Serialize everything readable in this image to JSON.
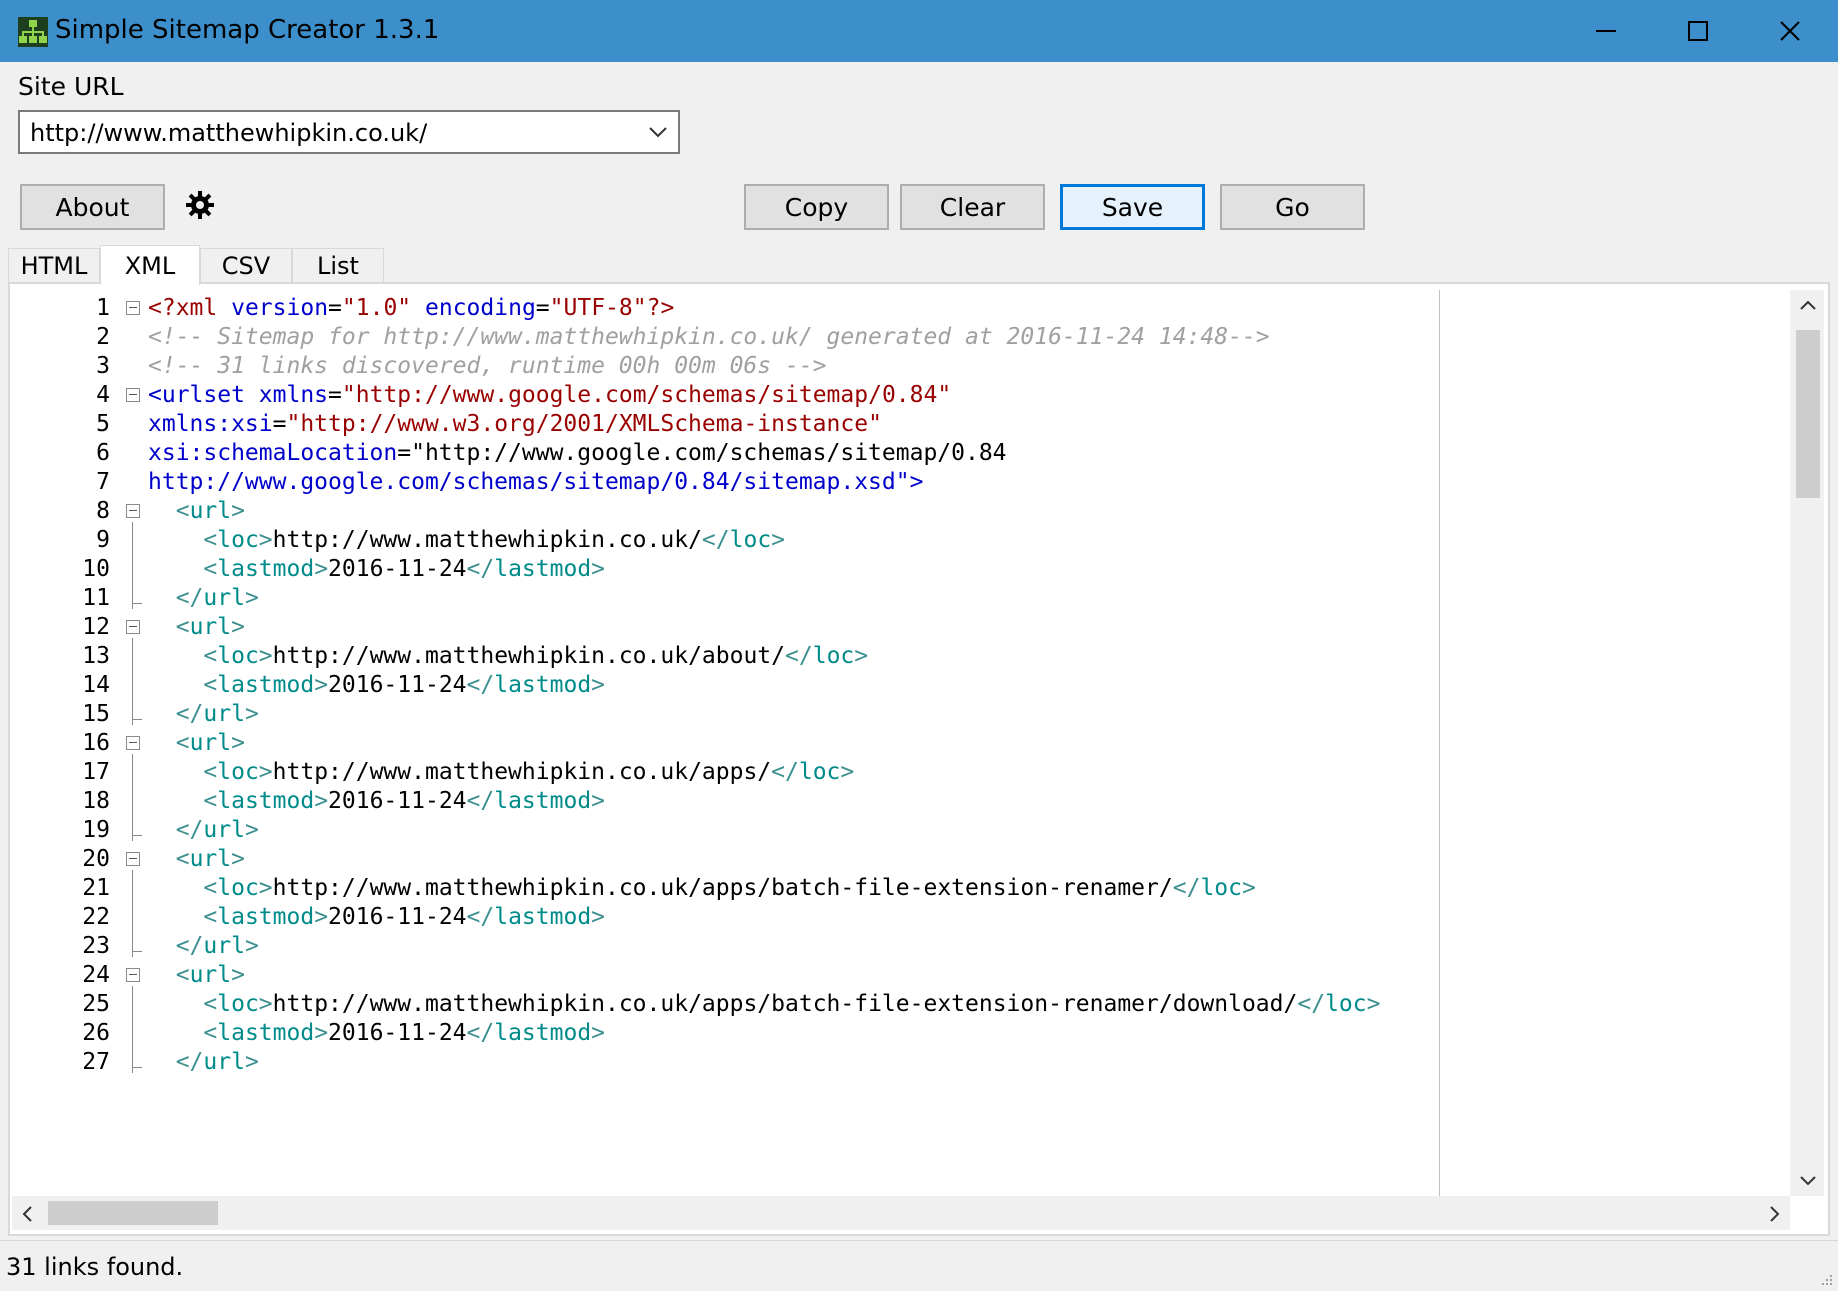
{
  "window": {
    "title": "Simple Sitemap Creator 1.3.1",
    "icon": "sitemap-app-icon",
    "controls": [
      "minimize-icon",
      "maximize-icon",
      "close-icon"
    ]
  },
  "site_url": {
    "label": "Site URL",
    "value": "http://www.matthewhipkin.co.uk/"
  },
  "toolbar": {
    "about_label": "About",
    "settings_icon": "gear-icon",
    "copy_label": "Copy",
    "clear_label": "Clear",
    "save_label": "Save",
    "go_label": "Go"
  },
  "tabs": [
    {
      "label": "HTML",
      "active": false
    },
    {
      "label": "XML",
      "active": true
    },
    {
      "label": "CSV",
      "active": false
    },
    {
      "label": "List",
      "active": false
    }
  ],
  "editor": {
    "lines": [
      {
        "n": "1",
        "text": "<?xml version=\"1.0\" encoding=\"UTF-8\"?>"
      },
      {
        "n": "2",
        "text": "<!-- Sitemap for http://www.matthewhipkin.co.uk/ generated at 2016-11-24 14:48-->"
      },
      {
        "n": "3",
        "text": "<!-- 31 links discovered, runtime 00h 00m 06s -->"
      },
      {
        "n": "4",
        "text": "<urlset xmlns=\"http://www.google.com/schemas/sitemap/0.84\""
      },
      {
        "n": "5",
        "text": "xmlns:xsi=\"http://www.w3.org/2001/XMLSchema-instance\""
      },
      {
        "n": "6",
        "text": "xsi:schemaLocation=\"http://www.google.com/schemas/sitemap/0.84"
      },
      {
        "n": "7",
        "text": "http://www.google.com/schemas/sitemap/0.84/sitemap.xsd\">"
      },
      {
        "n": "8",
        "text": "  <url>"
      },
      {
        "n": "9",
        "text": "    <loc>http://www.matthewhipkin.co.uk/</loc>"
      },
      {
        "n": "10",
        "text": "    <lastmod>2016-11-24</lastmod>"
      },
      {
        "n": "11",
        "text": "  </url>"
      },
      {
        "n": "12",
        "text": "  <url>"
      },
      {
        "n": "13",
        "text": "    <loc>http://www.matthewhipkin.co.uk/about/</loc>"
      },
      {
        "n": "14",
        "text": "    <lastmod>2016-11-24</lastmod>"
      },
      {
        "n": "15",
        "text": "  </url>"
      },
      {
        "n": "16",
        "text": "  <url>"
      },
      {
        "n": "17",
        "text": "    <loc>http://www.matthewhipkin.co.uk/apps/</loc>"
      },
      {
        "n": "18",
        "text": "    <lastmod>2016-11-24</lastmod>"
      },
      {
        "n": "19",
        "text": "  </url>"
      },
      {
        "n": "20",
        "text": "  <url>"
      },
      {
        "n": "21",
        "text": "    <loc>http://www.matthewhipkin.co.uk/apps/batch-file-extension-renamer/</loc>"
      },
      {
        "n": "22",
        "text": "    <lastmod>2016-11-24</lastmod>"
      },
      {
        "n": "23",
        "text": "  </url>"
      },
      {
        "n": "24",
        "text": "  <url>"
      },
      {
        "n": "25",
        "text": "    <loc>http://www.matthewhipkin.co.uk/apps/batch-file-extension-renamer/download/</loc>"
      },
      {
        "n": "26",
        "text": "    <lastmod>2016-11-24</lastmod>"
      },
      {
        "n": "27",
        "text": "  </url>"
      }
    ]
  },
  "status": {
    "text": "31 links found."
  },
  "colors": {
    "titlebar": "#3c8fcb",
    "default_button_border": "#0078d7",
    "xml_tag": "#0000cc",
    "xml_string": "#990000",
    "xml_comment": "#a0a0a0",
    "xml_inner_tag": "#008b8b"
  }
}
